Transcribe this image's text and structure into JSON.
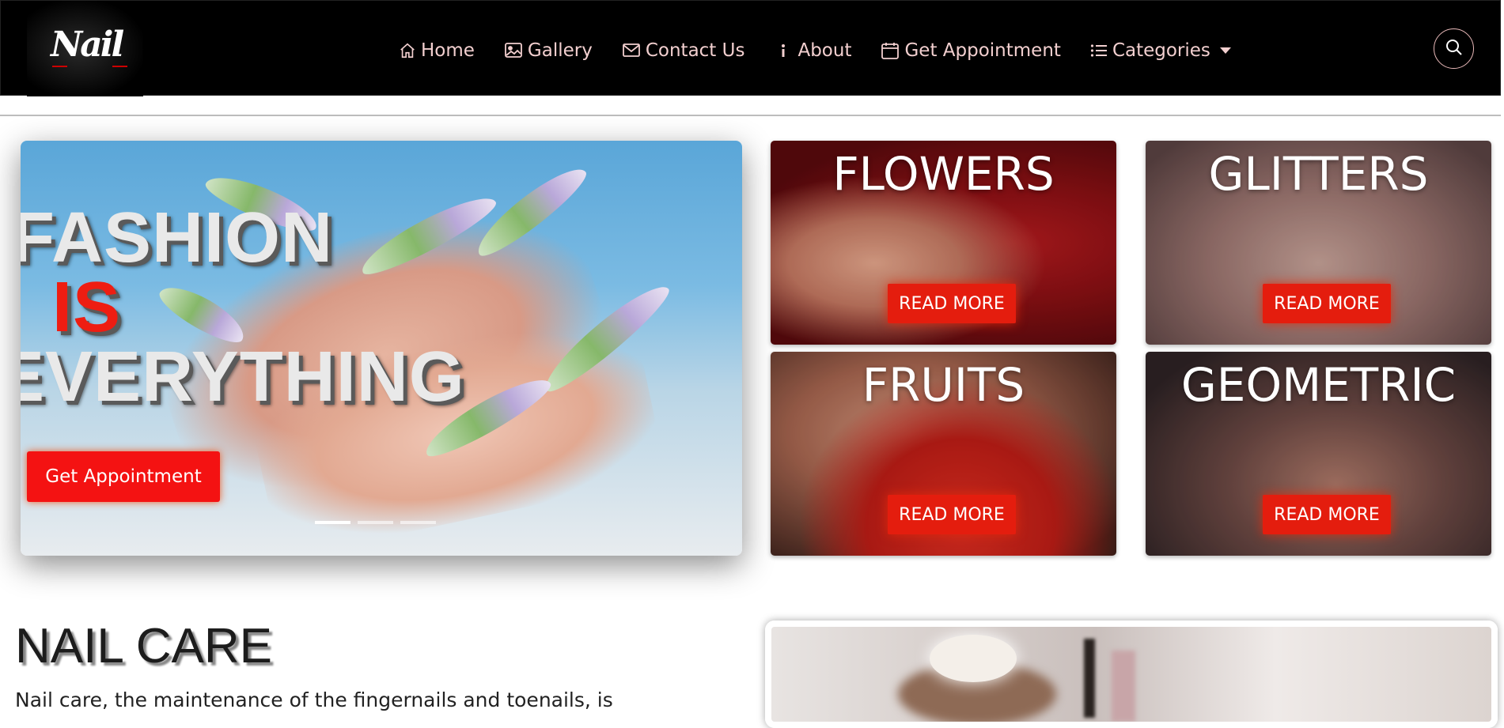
{
  "brand": {
    "logo_text": "Nail",
    "logo_icon": "nail-script-logo"
  },
  "nav": {
    "items": [
      {
        "label": "Home",
        "icon": "home-icon"
      },
      {
        "label": "Gallery",
        "icon": "image-icon"
      },
      {
        "label": "Contact Us",
        "icon": "envelope-icon"
      },
      {
        "label": "About",
        "icon": "info-icon"
      },
      {
        "label": "Get Appointment",
        "icon": "calendar-icon"
      },
      {
        "label": "Categories",
        "icon": "list-icon",
        "has_dropdown": true
      }
    ],
    "search_icon": "search-icon"
  },
  "hero": {
    "line1": "FASHION",
    "line2": "IS",
    "line3": "EVERYTHING",
    "button": "Get Appointment",
    "slide_count": 3,
    "active_slide": 1
  },
  "categories": [
    {
      "title": "FLOWERS",
      "button": "READ MORE"
    },
    {
      "title": "GLITTERS",
      "button": "READ MORE"
    },
    {
      "title": "FRUITS",
      "button": "READ MORE"
    },
    {
      "title": "GEOMETRIC",
      "button": "READ MORE"
    }
  ],
  "section": {
    "title": "NAIL CARE",
    "text": "Nail care, the maintenance of the fingernails and toenails, is"
  },
  "colors": {
    "nav_bg": "#000000",
    "nav_text": "#f2cfcf",
    "accent_red": "#f41212",
    "card_button": "#e41d0e"
  }
}
